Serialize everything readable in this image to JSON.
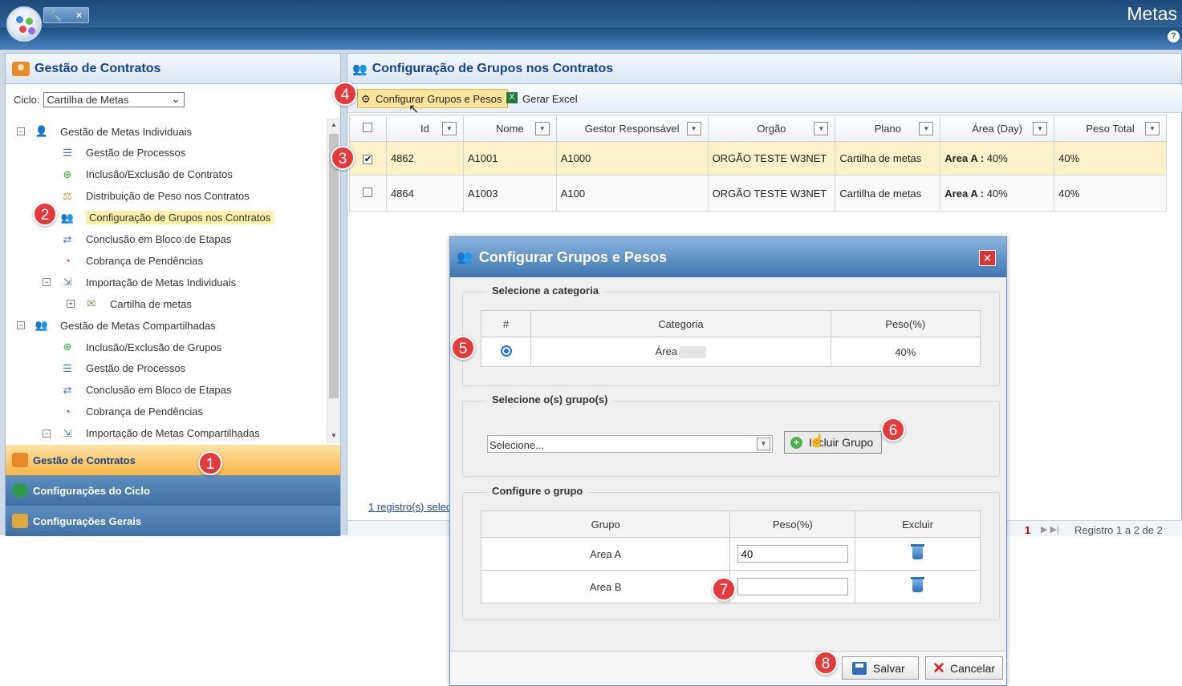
{
  "app": {
    "title": "Metas",
    "help": "?"
  },
  "left": {
    "header": "Gestão de Contratos",
    "ciclo_label": "Ciclo:",
    "ciclo_value": "Cartilha de Metas",
    "tree": [
      {
        "label": "Gestão de Metas Individuais",
        "icon": "user-icon",
        "expander": "−"
      },
      {
        "label": "Gestão de Processos",
        "icon": "process-icon"
      },
      {
        "label": "Inclusão/Exclusão de Contratos",
        "icon": "add-icon"
      },
      {
        "label": "Distribuição de Peso nos Contratos",
        "icon": "scale-icon"
      },
      {
        "label": "Configuração de Grupos nos Contratos",
        "icon": "groups-icon",
        "selected": true
      },
      {
        "label": "Conclusão em Bloco de Etapas",
        "icon": "block-icon"
      },
      {
        "label": "Cobrança de Pendências",
        "icon": "clock-icon"
      },
      {
        "label": "Importação de Metas Individuais",
        "icon": "import-icon",
        "expander": "−"
      },
      {
        "label": "Cartilha de metas",
        "icon": "money-icon",
        "expander": "+"
      },
      {
        "label": "Gestão de Metas Compartilhadas",
        "icon": "group-users-icon",
        "expander": "−"
      },
      {
        "label": "Inclusão/Exclusão de Grupos",
        "icon": "add-icon"
      },
      {
        "label": "Gestão de Processos",
        "icon": "process-icon"
      },
      {
        "label": "Conclusão em Bloco de Etapas",
        "icon": "block-icon"
      },
      {
        "label": "Cobrança de Pendências",
        "icon": "clock-icon"
      },
      {
        "label": "Importação de Metas Compartilhadas",
        "icon": "import-icon",
        "expander": "−"
      }
    ],
    "accordion": [
      "Gestão de Contratos",
      "Configurações do Ciclo",
      "Configurações Gerais"
    ]
  },
  "right": {
    "header": "Configuração de Grupos nos Contratos",
    "toolbar": {
      "config_btn": "Configurar Grupos e Pesos",
      "excel_btn": "Gerar Excel"
    },
    "columns": [
      "Id",
      "Nome",
      "Gestor Responsável",
      "Orgão",
      "Plano",
      "Área (Day)",
      "Peso Total"
    ],
    "rows": [
      {
        "checked": "✔",
        "id": "4862",
        "nome": "A1001",
        "gestor": "A1000",
        "orgao": "ORGÃO TESTE W3NET",
        "plano": "Cartilha de metas",
        "area_label": "Area A :",
        "area_value": " 40%",
        "peso": "40%"
      },
      {
        "checked": "",
        "id": "4864",
        "nome": "A1003",
        "gestor": "A100",
        "orgao": "ORGÃO TESTE W3NET",
        "plano": "Cartilha de metas",
        "area_label": "Area A :",
        "area_value": " 40%",
        "peso": "40%"
      }
    ],
    "selection_link": "1 registro(s) selec",
    "pager": {
      "page": "1",
      "info": "Registro 1 a 2 de 2"
    }
  },
  "modal": {
    "title": "Configurar Grupos e Pesos",
    "section1": "Selecione a categoria",
    "cat_headers": [
      "#",
      "Categoria",
      "Peso(%)"
    ],
    "cat_row": {
      "categoria": "Área",
      "peso": "40%"
    },
    "section2": "Selecione o(s) grupo(s)",
    "select_placeholder": "Selecione...",
    "incluir_btn": "Incluir Grupo",
    "section3": "Configure o grupo",
    "grp_headers": [
      "Grupo",
      "Peso(%)",
      "Excluir"
    ],
    "grp_rows": [
      {
        "grupo": "Area A",
        "peso": "40"
      },
      {
        "grupo": "Area B",
        "peso": ""
      }
    ],
    "salvar": "Salvar",
    "cancelar": "Cancelar"
  },
  "badges": [
    "1",
    "2",
    "3",
    "4",
    "5",
    "6",
    "7",
    "8"
  ],
  "colors": {
    "accent": "#15428b",
    "badge": "#e33b3b",
    "selected_row": "#fdf1c9"
  }
}
